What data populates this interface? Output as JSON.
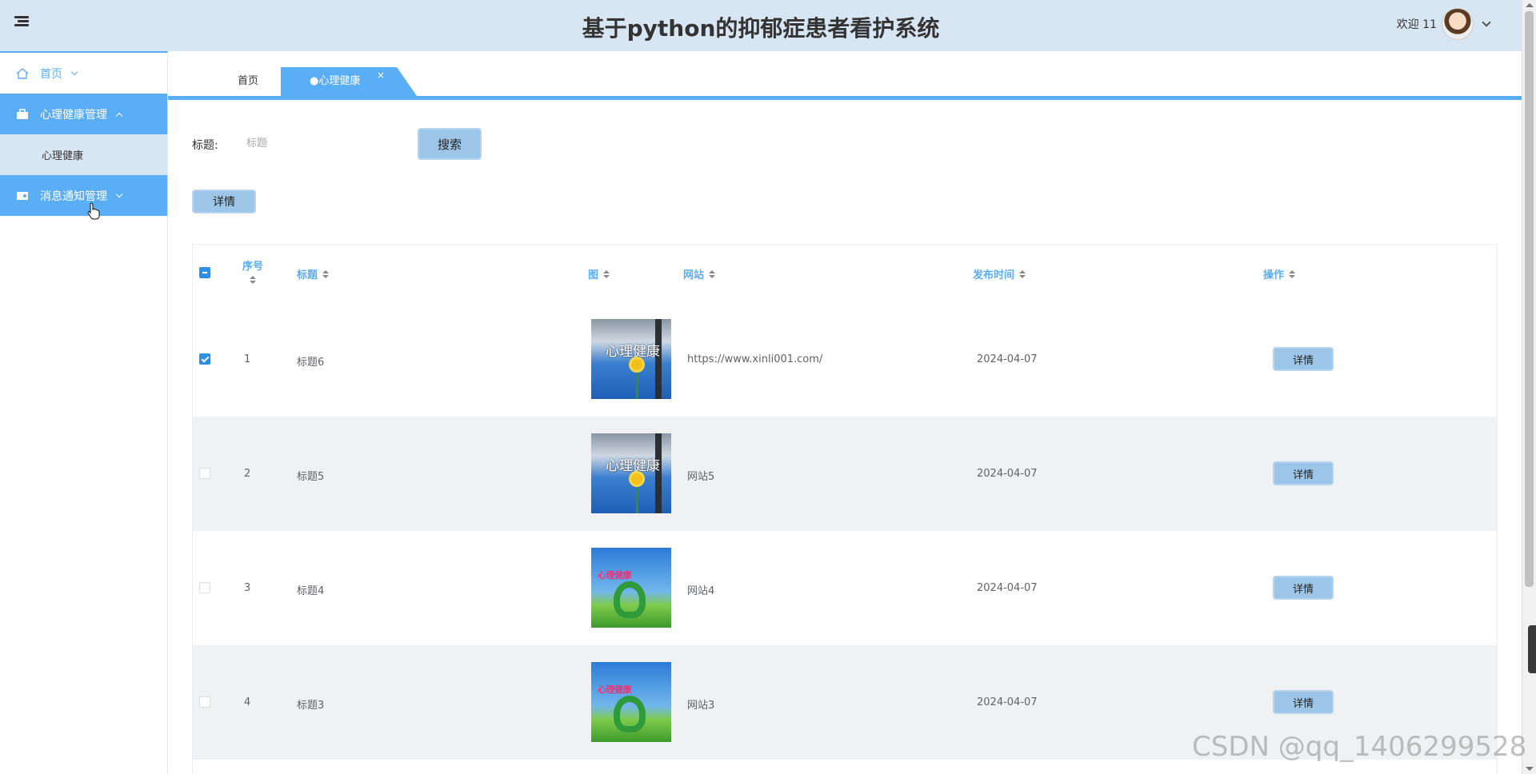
{
  "header": {
    "title": "基于python的抑郁症患者看护系统",
    "welcome": "欢迎 11"
  },
  "sidebar": {
    "items": [
      {
        "label": "首页"
      },
      {
        "label": "心理健康管理"
      },
      {
        "label": "心理健康"
      },
      {
        "label": "消息通知管理"
      }
    ]
  },
  "tabs": {
    "home": "首页",
    "active": "●心理健康",
    "close": "×"
  },
  "search": {
    "label": "标题:",
    "placeholder": "标题",
    "button": "搜索"
  },
  "toolbar": {
    "detail": "详情"
  },
  "table": {
    "columns": [
      "序号",
      "标题",
      "图",
      "网站",
      "发布时间",
      "操作"
    ],
    "rows": [
      {
        "index": "1",
        "title": "标题6",
        "image": "mental-health-sunflower",
        "site": "https://www.xinli001.com/",
        "date": "2024-04-07",
        "action": "详情",
        "checked": true
      },
      {
        "index": "2",
        "title": "标题5",
        "image": "mental-health-sunflower",
        "site": "网站5",
        "date": "2024-04-07",
        "action": "详情",
        "checked": false
      },
      {
        "index": "3",
        "title": "标题4",
        "image": "green-heart-meadow",
        "site": "网站4",
        "date": "2024-04-07",
        "action": "详情",
        "checked": false
      },
      {
        "index": "4",
        "title": "标题3",
        "image": "green-heart-meadow",
        "site": "网站3",
        "date": "2024-04-07",
        "action": "详情",
        "checked": false
      }
    ]
  },
  "thumbs": {
    "a_text": "心理健康",
    "b_text": "心理健康"
  },
  "watermark": "CSDN @qq_1406299528",
  "colors": {
    "header_bg": "#d8e6f4",
    "accent": "#59aef5",
    "button_bg": "#9cc5e8",
    "row_alt": "#f0f1f2"
  }
}
